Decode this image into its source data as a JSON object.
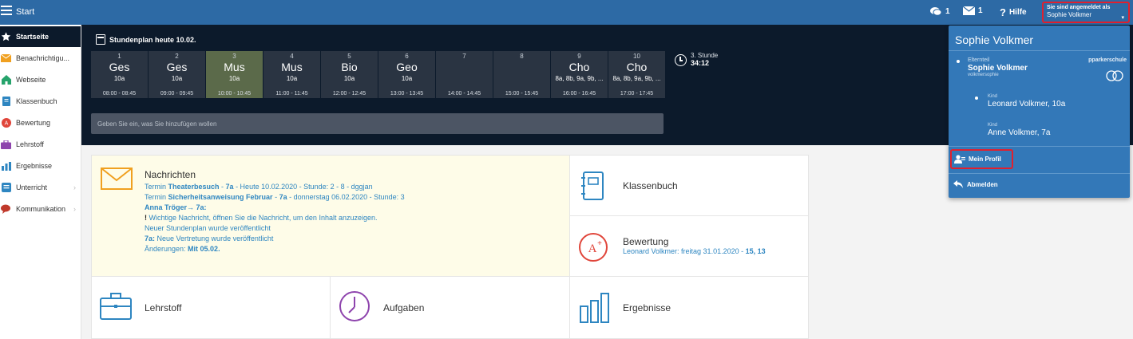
{
  "topbar": {
    "title": "Start",
    "messages_count": "1",
    "mail_count": "1",
    "help_label": "Hilfe",
    "logged_in_label": "Sie sind angemeldet als",
    "user_name": "Sophie Volkmer",
    "caret": "▾"
  },
  "sidebar": {
    "items": [
      {
        "label": "Startseite",
        "icon": "star-icon"
      },
      {
        "label": "Benachrichtigu...",
        "icon": "envelope-icon"
      },
      {
        "label": "Webseite",
        "icon": "house-icon"
      },
      {
        "label": "Klassenbuch",
        "icon": "book-icon"
      },
      {
        "label": "Bewertung",
        "icon": "grade-icon"
      },
      {
        "label": "Lehrstoff",
        "icon": "briefcase-icon"
      },
      {
        "label": "Ergebnisse",
        "icon": "bar-chart-icon"
      },
      {
        "label": "Unterricht",
        "icon": "lesson-icon"
      },
      {
        "label": "Kommunikation",
        "icon": "chat-icon"
      }
    ],
    "chevron": "›"
  },
  "schedule": {
    "title": "Stundenplan heute 10.02.",
    "periods": [
      {
        "num": "1",
        "subject": "Ges",
        "cls": "10a",
        "time": "08:00 - 08:45"
      },
      {
        "num": "2",
        "subject": "Ges",
        "cls": "10a",
        "time": "09:00 - 09:45"
      },
      {
        "num": "3",
        "subject": "Mus",
        "cls": "10a",
        "time": "10:00 - 10:45"
      },
      {
        "num": "4",
        "subject": "Mus",
        "cls": "10a",
        "time": "11:00 - 11:45"
      },
      {
        "num": "5",
        "subject": "Bio",
        "cls": "10a",
        "time": "12:00 - 12:45"
      },
      {
        "num": "6",
        "subject": "Geo",
        "cls": "10a",
        "time": "13:00 - 13:45"
      },
      {
        "num": "7",
        "subject": "",
        "cls": "",
        "time": "14:00 - 14:45"
      },
      {
        "num": "8",
        "subject": "",
        "cls": "",
        "time": "15:00 - 15:45"
      },
      {
        "num": "9",
        "subject": "Cho",
        "cls": "8a, 8b, 9a, 9b, ...",
        "time": "16:00 - 16:45"
      },
      {
        "num": "10",
        "subject": "Cho",
        "cls": "8a, 8b, 9a, 9b, ...",
        "time": "17:00 - 17:45"
      }
    ],
    "current_period_label": "3. Stunde",
    "countdown": "34:12",
    "input_placeholder": "Geben Sie ein, was Sie hinzufügen wollen"
  },
  "tiles": {
    "news": {
      "title": "Nachrichten",
      "l1_a": "Termin ",
      "l1_b": "Theaterbesuch",
      "l1_c": " - ",
      "l1_d": "7a",
      "l1_e": " - Heute 10.02.2020 - Stunde: 2 - 8 - dggjan",
      "l2_a": "Termin ",
      "l2_b": "Sicherheitsanweisung Februar",
      "l2_c": " - ",
      "l2_d": "7a",
      "l2_e": " - donnerstag 06.02.2020 - Stunde: 3",
      "l3": "Anna Tröger→ 7a:",
      "l4_mark": "!",
      "l4": " Wichtige Nachricht, öffnen Sie die Nachricht, um den Inhalt anzuzeigen.",
      "l5": "Neuer Stundenplan wurde veröffentlicht",
      "l6_a": "7a:",
      "l6_b": " Neue Vertretung wurde veröffentlicht",
      "l7_a": "Änderungen: ",
      "l7_b": "Mit 05.02."
    },
    "klassenbuch": {
      "title": "Klassenbuch"
    },
    "bewertung": {
      "title": "Bewertung",
      "sub_a": "Leonard Volkmer: freitag 31.01.2020 - ",
      "sub_b": "15, 13"
    },
    "lehrstoff": {
      "title": "Lehrstoff"
    },
    "aufgaben": {
      "title": "Aufgaben"
    },
    "ergebnisse": {
      "title": "Ergebnisse"
    }
  },
  "dropdown": {
    "name": "Sophie Volkmer",
    "role_label": "Elternteil",
    "role_name": "Sophie Volkmer",
    "username": "volkmersophie",
    "school": "pparkerschule",
    "kids": [
      {
        "label": "Kind",
        "name": "Leonard Volkmer, 10a"
      },
      {
        "label": "Kind",
        "name": "Anne Volkmer, 7a"
      }
    ],
    "profile_label": "Mein Profil",
    "logout_label": "Abmelden"
  },
  "colors": {
    "topbar": "#2d6aa5",
    "dark_header": "#0c1a2b",
    "period_bg": "#2a3442",
    "period_current": "#5b6a4a",
    "accent_blue": "#2e86c1",
    "dropdown_bg": "#3378b8",
    "highlight_red": "#e0202e",
    "news_bg": "#fefce8"
  }
}
